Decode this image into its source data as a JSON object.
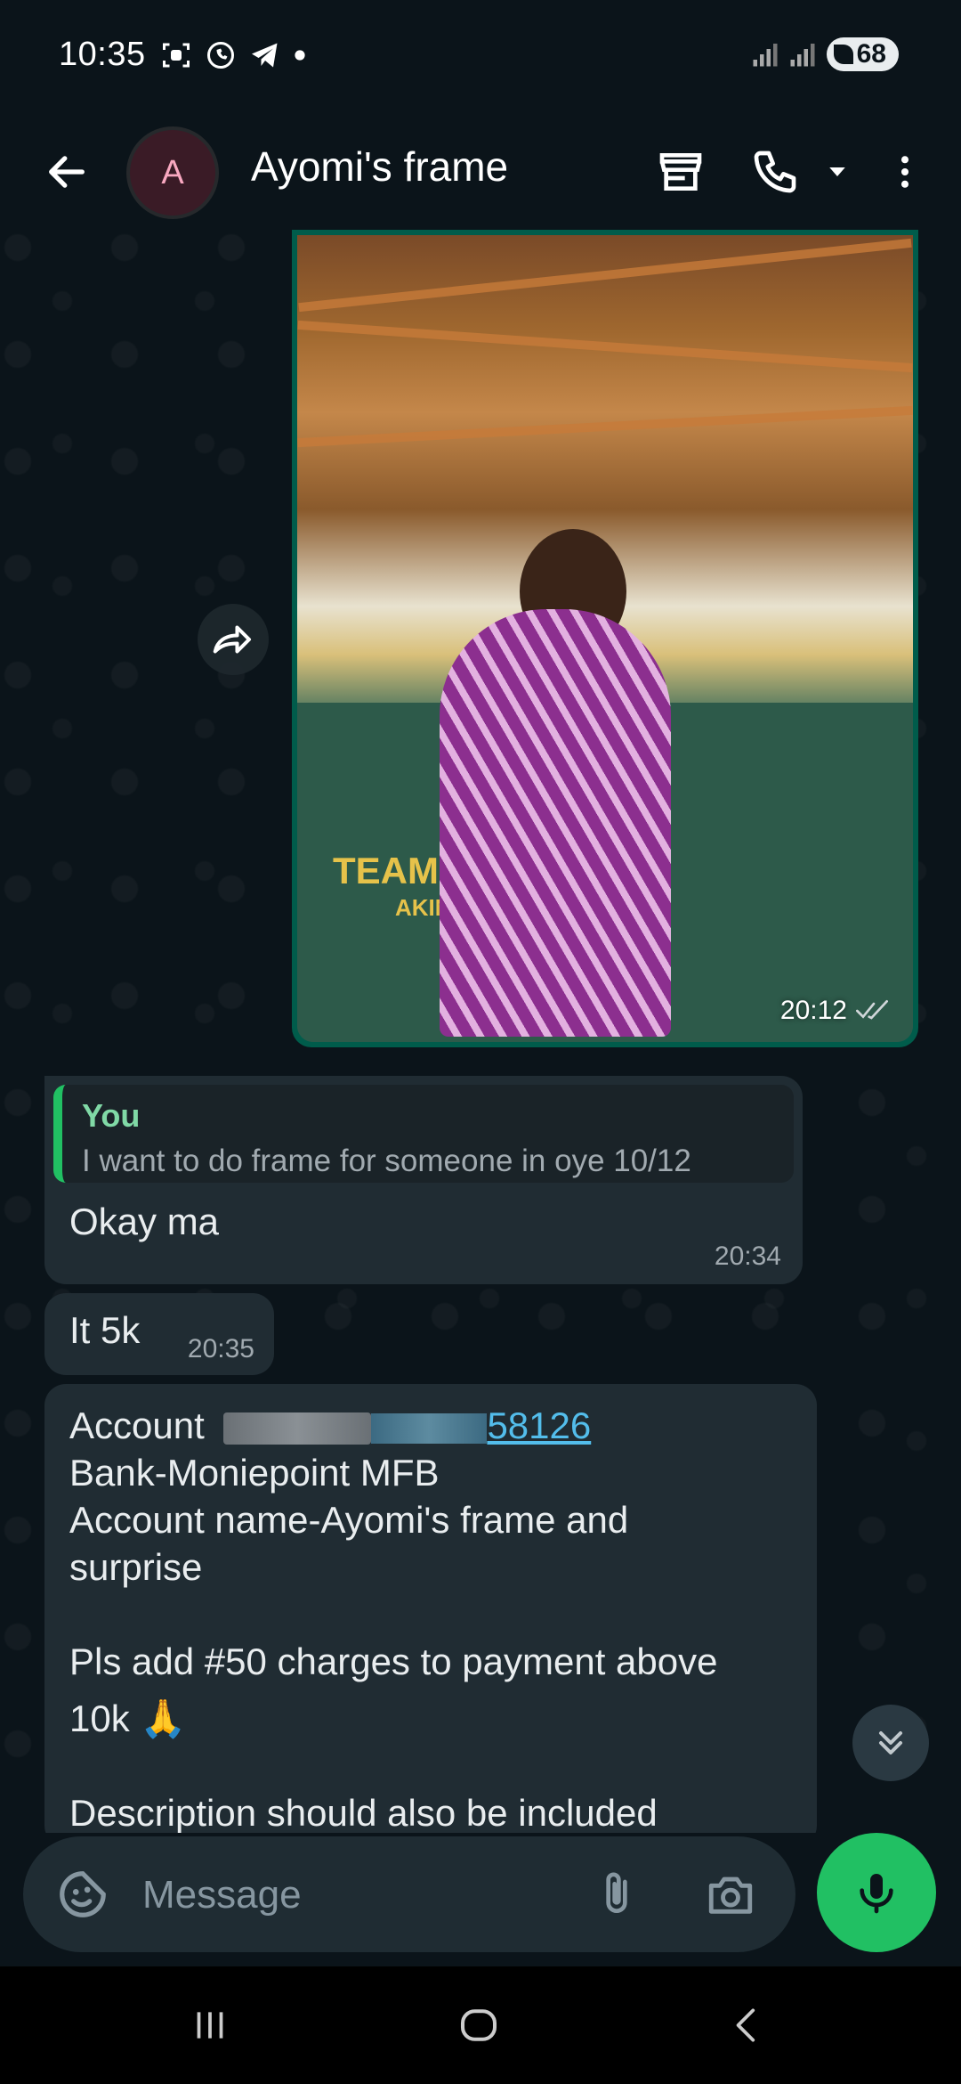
{
  "status_bar": {
    "time": "10:35",
    "battery": "68",
    "left_icons": [
      "screenshot-icon",
      "whatsapp-icon",
      "telegram-icon",
      "dot-icon"
    ],
    "right_icons": [
      "signal-icon",
      "signal-icon",
      "battery-icon"
    ]
  },
  "header": {
    "avatar_letter": "A",
    "title": "Ayomi's frame",
    "icons": [
      "back-arrow-icon",
      "store-icon",
      "phone-icon",
      "dropdown-icon",
      "more-vert-icon"
    ]
  },
  "messages": {
    "photo": {
      "wall_text": "TEAM POSIT",
      "wall_sub": "AKINTOYE L",
      "time": "20:12"
    },
    "reply": {
      "quote_author": "You",
      "quote_text": "I want to do frame for someone in oye 10/12",
      "text": "Okay ma",
      "time": "20:34"
    },
    "price": {
      "text": "It 5k",
      "time": "20:35"
    },
    "account": {
      "label": "Account",
      "number_visible": "58126",
      "bank": "Bank-Moniepoint MFB",
      "account_name_line1": "Account name-Ayomi's frame and",
      "account_name_line2": "surprise",
      "charges_line1": "Pls add #50 charges to payment above",
      "charges_line2": "10k 🙏",
      "description": "Description should also be included"
    }
  },
  "input": {
    "placeholder": "Message"
  },
  "colors": {
    "background": "#0b141a",
    "incoming_bubble": "#202c33",
    "outgoing_bubble": "#005c4b",
    "accent_green": "#21c063",
    "link": "#53bdeb"
  }
}
